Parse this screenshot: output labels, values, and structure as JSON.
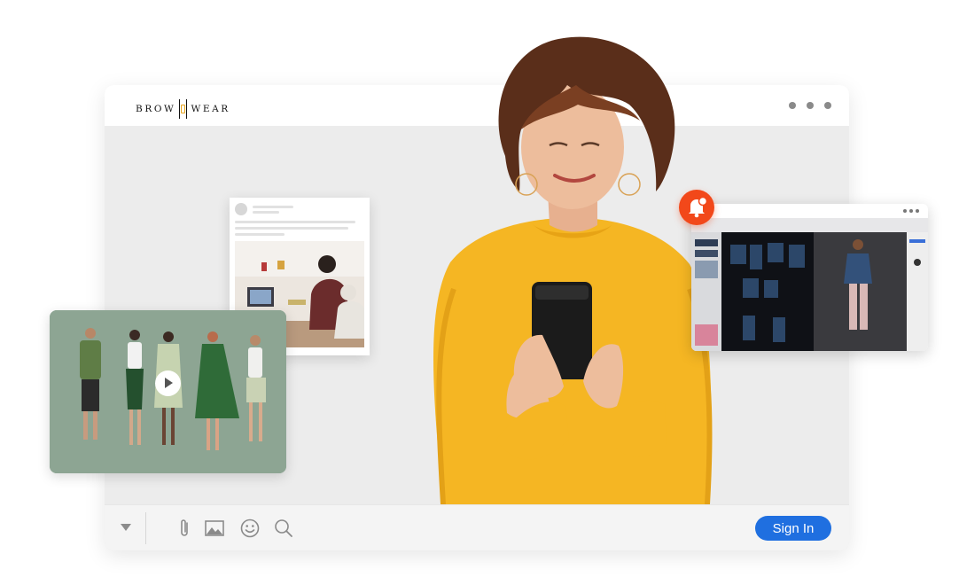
{
  "brand": {
    "logo_left": "BROW",
    "logo_right": "WEAR",
    "accent": "#e8a31a"
  },
  "window": {
    "menu_dots": "more-options-icon"
  },
  "footer": {
    "icons": [
      "chevron-down-icon",
      "paperclip-icon",
      "image-icon",
      "emoji-icon",
      "search-icon"
    ],
    "sign_in_label": "Sign In",
    "button_color": "#1f6fe0"
  },
  "media": {
    "video_icon": "play-icon",
    "notification_icon": "bell-icon",
    "notification_color": "#f2481a"
  }
}
